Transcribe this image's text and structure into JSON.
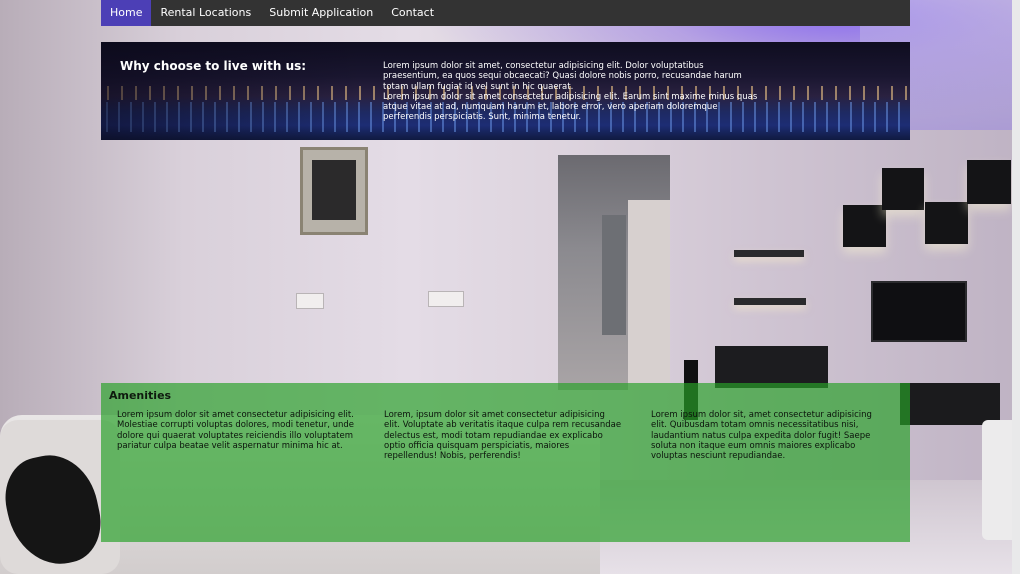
{
  "nav": {
    "items": [
      {
        "label": "Home",
        "active": true
      },
      {
        "label": "Rental Locations",
        "active": false
      },
      {
        "label": "Submit Application",
        "active": false
      },
      {
        "label": "Contact",
        "active": false
      }
    ],
    "active_color": "#4c3fb6",
    "bar_color": "#333333"
  },
  "hero": {
    "title": "Why choose to live with us:",
    "paragraph1": "Lorem ipsum dolor sit amet, consectetur adipisicing elit. Dolor voluptatibus praesentium, ea quos sequi obcaecati? Quasi dolore nobis porro, recusandae harum totam ullam fugiat id vel sunt in hic quaerat.",
    "paragraph2": "Lorem ipsum dolor sit amet consectetur adipisicing elit. Earum sint maxime minus quas atque vitae at ad, numquam harum et, labore error, vero aperiam doloremque perferendis perspiciatis. Sunt, minima tenetur."
  },
  "amenities": {
    "title": "Amenities",
    "color": "#28a028",
    "columns": [
      "Lorem ipsum dolor sit amet consectetur adipisicing elit. Molestiae corrupti voluptas dolores, modi tenetur, unde dolore qui quaerat voluptates reiciendis illo voluptatem pariatur culpa beatae velit aspernatur minima hic at.",
      "Lorem, ipsum dolor sit amet consectetur adipisicing elit. Voluptate ab veritatis itaque culpa rem recusandae delectus est, modi totam repudiandae ex explicabo optio officia quisquam perspiciatis, maiores repellendus! Nobis, perferendis!",
      "Lorem ipsum dolor sit, amet consectetur adipisicing elit. Quibusdam totam omnis necessitatibus nisi, laudantium natus culpa expedita dolor fugit! Saepe soluta non itaque eum omnis maiores explicabo voluptas nesciunt repudiandae."
    ]
  }
}
